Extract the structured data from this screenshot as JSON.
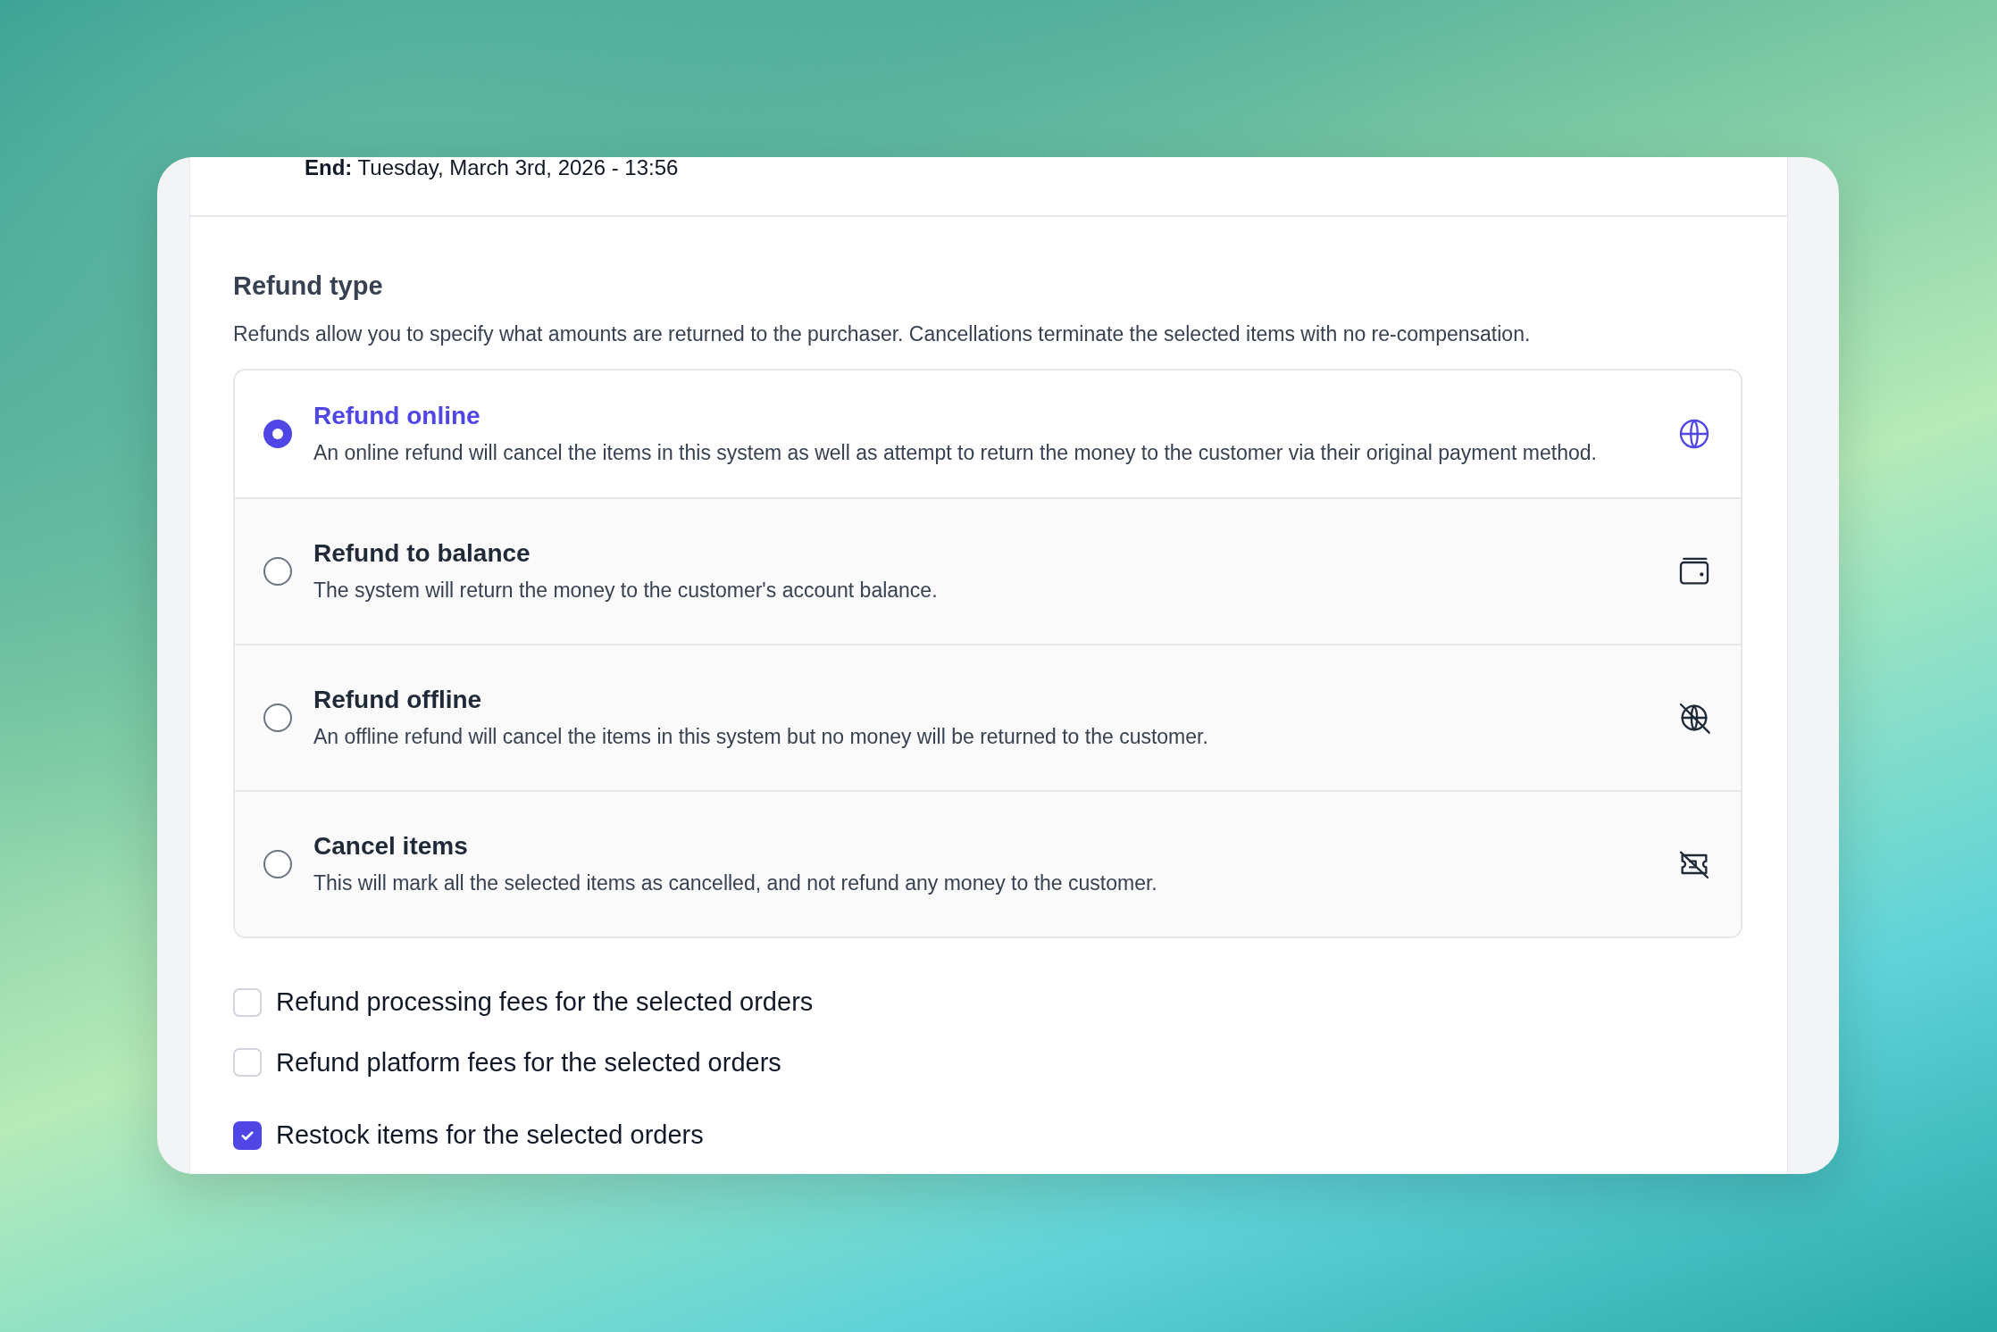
{
  "end": {
    "label": "End:",
    "value": "Tuesday, March 3rd, 2026 - 13:56"
  },
  "refund_type": {
    "title": "Refund type",
    "description": "Refunds allow you to specify what amounts are returned to the purchaser. Cancellations terminate the selected items with no re-compensation.",
    "options": [
      {
        "kind": "online",
        "title": "Refund online",
        "description": "An online refund will cancel the items in this system as well as attempt to return the money to the customer via their original payment method.",
        "selected": true
      },
      {
        "kind": "balance",
        "title": "Refund to balance",
        "description": "The system will return the money to the customer's account balance.",
        "selected": false
      },
      {
        "kind": "offline",
        "title": "Refund offline",
        "description": "An offline refund will cancel the items in this system but no money will be returned to the customer.",
        "selected": false
      },
      {
        "kind": "cancel",
        "title": "Cancel items",
        "description": "This will mark all the selected items as cancelled, and not refund any money to the customer.",
        "selected": false
      }
    ]
  },
  "fee_options": [
    {
      "label": "Refund processing fees for the selected orders",
      "checked": false
    },
    {
      "label": "Refund platform fees for the selected orders",
      "checked": false
    }
  ],
  "restock": {
    "label": "Restock items for the selected orders",
    "checked": true
  }
}
